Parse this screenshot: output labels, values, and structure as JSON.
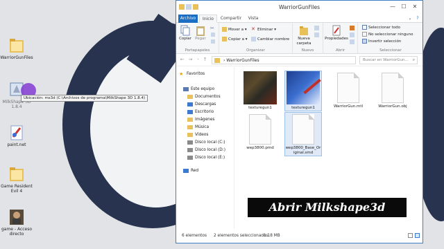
{
  "desktop": {
    "icons": [
      {
        "label": "WarriorGunFiles",
        "kind": "folder"
      },
      {
        "label": "MilkShape 3D 1.8.4",
        "kind": "milkshape"
      },
      {
        "label": "paint.net",
        "kind": "paint"
      },
      {
        "label": "Game Resident Evil 4",
        "kind": "folder"
      },
      {
        "label": "game - Acceso directo",
        "kind": "shortcut"
      }
    ],
    "tooltip": "Ubicación: ms3d (C:\\Archivos de programa\\MilkShape 3D 1.8.4)"
  },
  "window": {
    "title": "WarriorGunFiles",
    "controls": {
      "minimize": "—",
      "maximize": "☐",
      "close": "✕"
    },
    "tabs": [
      "Archivo",
      "Inicio",
      "Compartir",
      "Vista"
    ],
    "ribbon": {
      "portapapeles": {
        "label": "Portapapeles",
        "copy": "Copiar",
        "paste": "Pegar"
      },
      "organizar": {
        "label": "Organizar",
        "move": "Mover a ▾",
        "copyto": "Copiar a ▾",
        "delete": "Eliminar ▾",
        "rename": "Cambiar nombre"
      },
      "nuevo": {
        "label": "Nuevo",
        "newfolder": "Nueva carpeta"
      },
      "abrir": {
        "label": "Abrir",
        "properties": "Propiedades"
      },
      "seleccionar": {
        "label": "Seleccionar",
        "all": "Seleccionar todo",
        "none": "No seleccionar ninguno",
        "invert": "Invertir selección"
      }
    },
    "address": {
      "back": "←",
      "forward": "→",
      "up": "↑",
      "path": "›  WarriorGunFiles",
      "search_placeholder": "Buscar en WarriorGun..."
    },
    "nav": {
      "favorites": "Favoritos",
      "thispc": "Este equipo",
      "items": [
        "Documentos",
        "Descargas",
        "Escritorio",
        "Imágenes",
        "Música",
        "Vídeos",
        "Disco local (C:)",
        "Disco local (D:)",
        "Disco local (E:)"
      ],
      "network": "Red"
    },
    "files": [
      {
        "name": "texturegun1",
        "kind": "texture-dark"
      },
      {
        "name": "texturegun1",
        "kind": "texture-paint"
      },
      {
        "name": "WarriorGun.mtl",
        "kind": "doc"
      },
      {
        "name": "WarriorGun.obj",
        "kind": "doc"
      },
      {
        "name": "wep3800.pmd",
        "kind": "doc"
      },
      {
        "name": "wep3800_Base_Original.smd",
        "kind": "doc"
      }
    ],
    "status": {
      "count": "6 elementos",
      "selected": "2 elementos seleccionados",
      "size": "1.18 MB"
    }
  },
  "overlay": {
    "banner": "Abrir Milkshape3d"
  },
  "colors": {
    "accent": "#1a6fc4",
    "selection": "#dfe9f7",
    "banner_bg": "#0a0a0a",
    "cursor": "#8a3fd6"
  }
}
